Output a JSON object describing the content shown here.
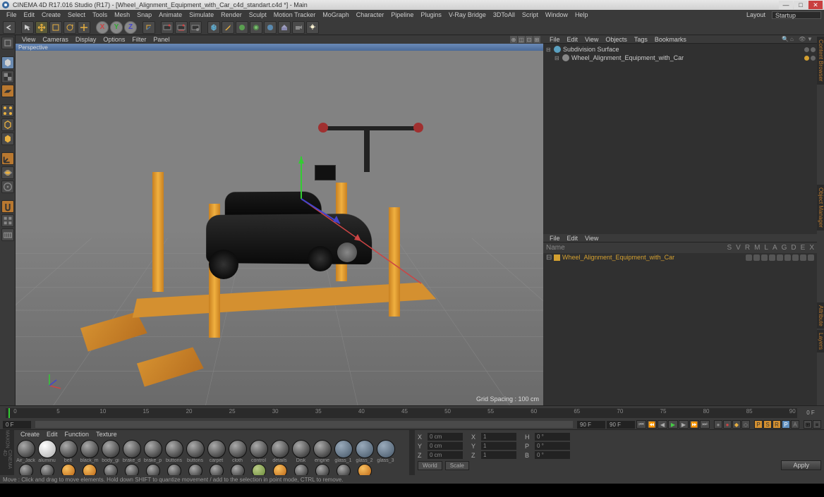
{
  "window": {
    "title": "CINEMA 4D R17.016 Studio (R17) - [Wheel_Alignment_Equipment_with_Car_c4d_standart.c4d *] - Main"
  },
  "menubar": {
    "items": [
      "File",
      "Edit",
      "Create",
      "Select",
      "Tools",
      "Mesh",
      "Snap",
      "Animate",
      "Simulate",
      "Render",
      "Sculpt",
      "Motion Tracker",
      "MoGraph",
      "Character",
      "Pipeline",
      "Plugins",
      "V-Ray Bridge",
      "3DToAll",
      "Script",
      "Window",
      "Help"
    ],
    "layout_label": "Layout",
    "layout_value": "Startup"
  },
  "viewport": {
    "menu": [
      "View",
      "Cameras",
      "Display",
      "Options",
      "Filter",
      "Panel"
    ],
    "mode": "Perspective",
    "grid_status": "Grid Spacing : 100 cm"
  },
  "objpanel": {
    "menu": [
      "File",
      "Edit",
      "View",
      "Objects",
      "Tags",
      "Bookmarks"
    ],
    "items": [
      {
        "label": "Subdivision Surface",
        "icon": "#5aa0c0"
      },
      {
        "label": "Wheel_Alignment_Equipment_with_Car",
        "icon": "#888",
        "indent": 1,
        "dots": [
          "#d4a030",
          "#666"
        ]
      }
    ]
  },
  "attrpanel": {
    "menu": [
      "File",
      "Edit",
      "View"
    ],
    "columns": [
      "Name",
      "S",
      "V",
      "R",
      "M",
      "L",
      "A",
      "G",
      "D",
      "E",
      "X"
    ],
    "item": "Wheel_Alignment_Equipment_with_Car"
  },
  "timeline": {
    "ticks": [
      "0",
      "5",
      "10",
      "15",
      "20",
      "25",
      "30",
      "35",
      "40",
      "45",
      "50",
      "55",
      "60",
      "65",
      "70",
      "75",
      "80",
      "85",
      "90"
    ],
    "start": "0 F",
    "end_in": "90 F",
    "end_out": "90 F",
    "readout_right": "0 F"
  },
  "materials": {
    "menu": [
      "Create",
      "Edit",
      "Function",
      "Texture"
    ],
    "items": [
      "Air_Jack",
      "aluminu",
      "belt",
      "black_m",
      "body_gi",
      "brake_d",
      "brake_p",
      "buttons",
      "buttons",
      "carpet",
      "cloth",
      "control",
      "details",
      "Disk",
      "engine",
      "glass_1",
      "glass_2",
      "glass_3"
    ],
    "row2_count": 18
  },
  "coords": {
    "x": "0 cm",
    "y": "0 cm",
    "z": "0 cm",
    "sx": "1",
    "sy": "1",
    "sz": "1",
    "hh": "0 °",
    "pp": "0 °",
    "bb": "0 °",
    "mode1": "World",
    "mode2": "Scale",
    "apply": "Apply",
    "labels": {
      "X": "X",
      "Y": "Y",
      "Z": "Z",
      "X2": "X",
      "Y2": "Y",
      "Z2": "Z",
      "H": "H",
      "P": "P",
      "B": "B"
    }
  },
  "statusbar": "Move : Click and drag to move elements. Hold down SHIFT to quantize movement / add to the selection in point mode, CTRL to remove.",
  "sidetabs": [
    "Content Browser",
    "Object Manager",
    "Attribute",
    "Layers"
  ]
}
